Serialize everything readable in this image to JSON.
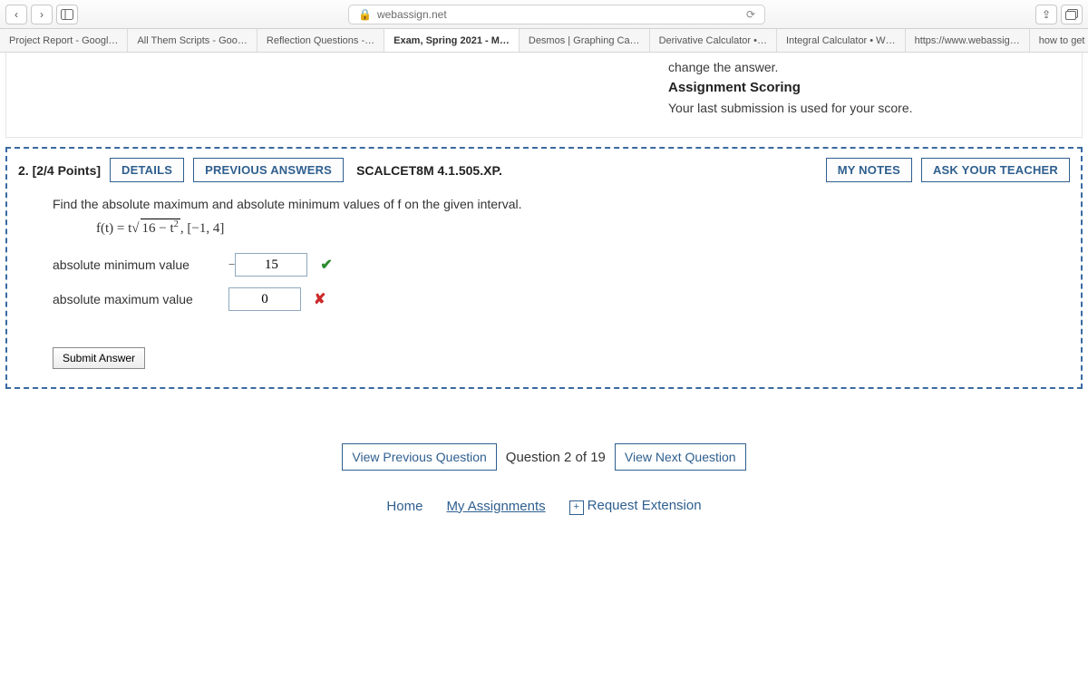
{
  "browser": {
    "url_host": "webassign.net",
    "tabs": [
      "Project Report - Googl…",
      "All Them Scripts - Goo…",
      "Reflection Questions -…",
      "Exam, Spring 2021 - M…",
      "Desmos | Graphing Ca…",
      "Derivative Calculator •…",
      "Integral Calculator • W…",
      "https://www.webassig…",
      "how to get inflection p…"
    ],
    "active_tab_index": 3
  },
  "top_panel": {
    "change_line": "change the answer.",
    "heading": "Assignment Scoring",
    "desc": "Your last submission is used for your score."
  },
  "question": {
    "number_points": "2.  [2/4 Points]",
    "details_btn": "DETAILS",
    "prev_ans_btn": "PREVIOUS ANSWERS",
    "reference": "SCALCET8M 4.1.505.XP.",
    "my_notes_btn": "MY NOTES",
    "ask_teacher_btn": "ASK YOUR TEACHER",
    "prompt": "Find the absolute maximum and absolute minimum values of f on the given interval.",
    "formula_prefix": "f(t) = t",
    "formula_radicand": "16 − t",
    "formula_interval": ",    [−1, 4]",
    "rows": [
      {
        "label": "absolute minimum value",
        "value": "15",
        "neg": "−",
        "mark": "ok"
      },
      {
        "label": "absolute maximum value",
        "value": "0",
        "neg": "",
        "mark": "bad"
      }
    ],
    "submit_label": "Submit Answer"
  },
  "nav": {
    "prev": "View Previous Question",
    "label": "Question 2 of 19",
    "next": "View Next Question"
  },
  "footer": {
    "home": "Home",
    "my_assignments": "My Assignments",
    "request_ext": "Request Extension"
  }
}
